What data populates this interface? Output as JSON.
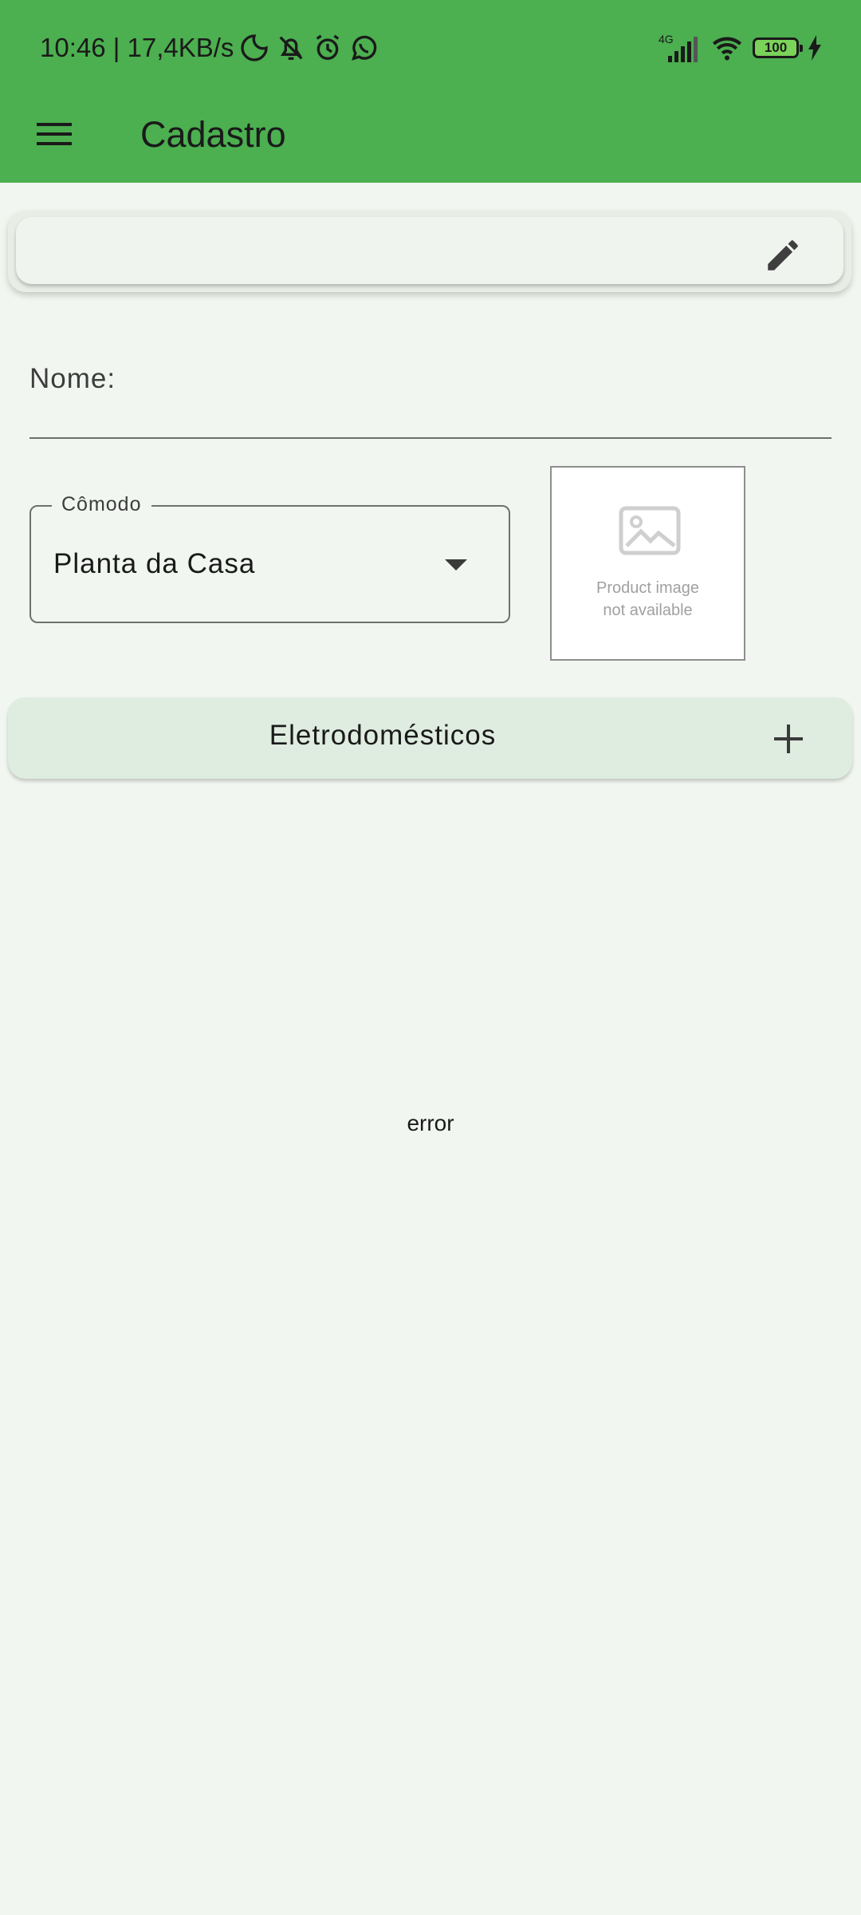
{
  "status_bar": {
    "time_speed": "10:46 | 17,4KB/s",
    "network": "4G",
    "battery": "100"
  },
  "app_bar": {
    "title": "Cadastro"
  },
  "form": {
    "name_label": "Nome:",
    "name_value": "",
    "room_label": "Cômodo",
    "room_value": "Planta da Casa",
    "image_placeholder_line1": "Product image",
    "image_placeholder_line2": "not available"
  },
  "appliances": {
    "label": "Eletrodomésticos"
  },
  "message": {
    "text": "error"
  },
  "colors": {
    "app_bar": "#4caf50",
    "background": "#f1f6f0",
    "section_bar": "#dfece0"
  }
}
